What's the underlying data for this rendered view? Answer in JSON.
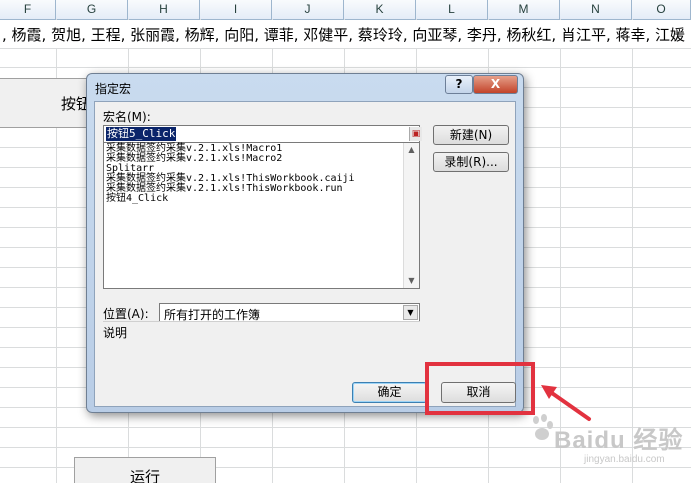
{
  "spreadsheet": {
    "columns": [
      "F",
      "G",
      "H",
      "I",
      "J",
      "K",
      "L",
      "M",
      "N",
      "O"
    ],
    "row1_text": ", 杨霞, 贺旭, 王程, 张丽霞, 杨辉, 向阳, 谭菲, 邓健平, 蔡玲玲, 向亚琴, 李丹, 杨秋红, 肖江平, 蒋幸, 江媛",
    "button1_label": "按钮",
    "button2_label": "运行"
  },
  "dialog": {
    "title": "指定宏",
    "help_label": "?",
    "close_label": "X",
    "macro_name_label": "宏名(M):",
    "macro_name_value": "按钮5_Click",
    "macro_list": [
      "采集数据签约采集v.2.1.xls!Macro1",
      "采集数据签约采集v.2.1.xls!Macro2",
      "Splitarr",
      "采集数据签约采集v.2.1.xls!ThisWorkbook.caiji",
      "采集数据签约采集v.2.1.xls!ThisWorkbook.run",
      "按钮4_Click"
    ],
    "new_button": "新建(N)",
    "record_button": "录制(R)...",
    "location_label": "位置(A):",
    "location_value": "所有打开的工作簿",
    "description_label": "说明",
    "ok_button": "确定",
    "cancel_button": "取消"
  },
  "annotation": {
    "highlight_color": "#e2323f"
  },
  "watermark": {
    "text": "Baidu 经验",
    "sub": "jingyan.baidu.com"
  }
}
